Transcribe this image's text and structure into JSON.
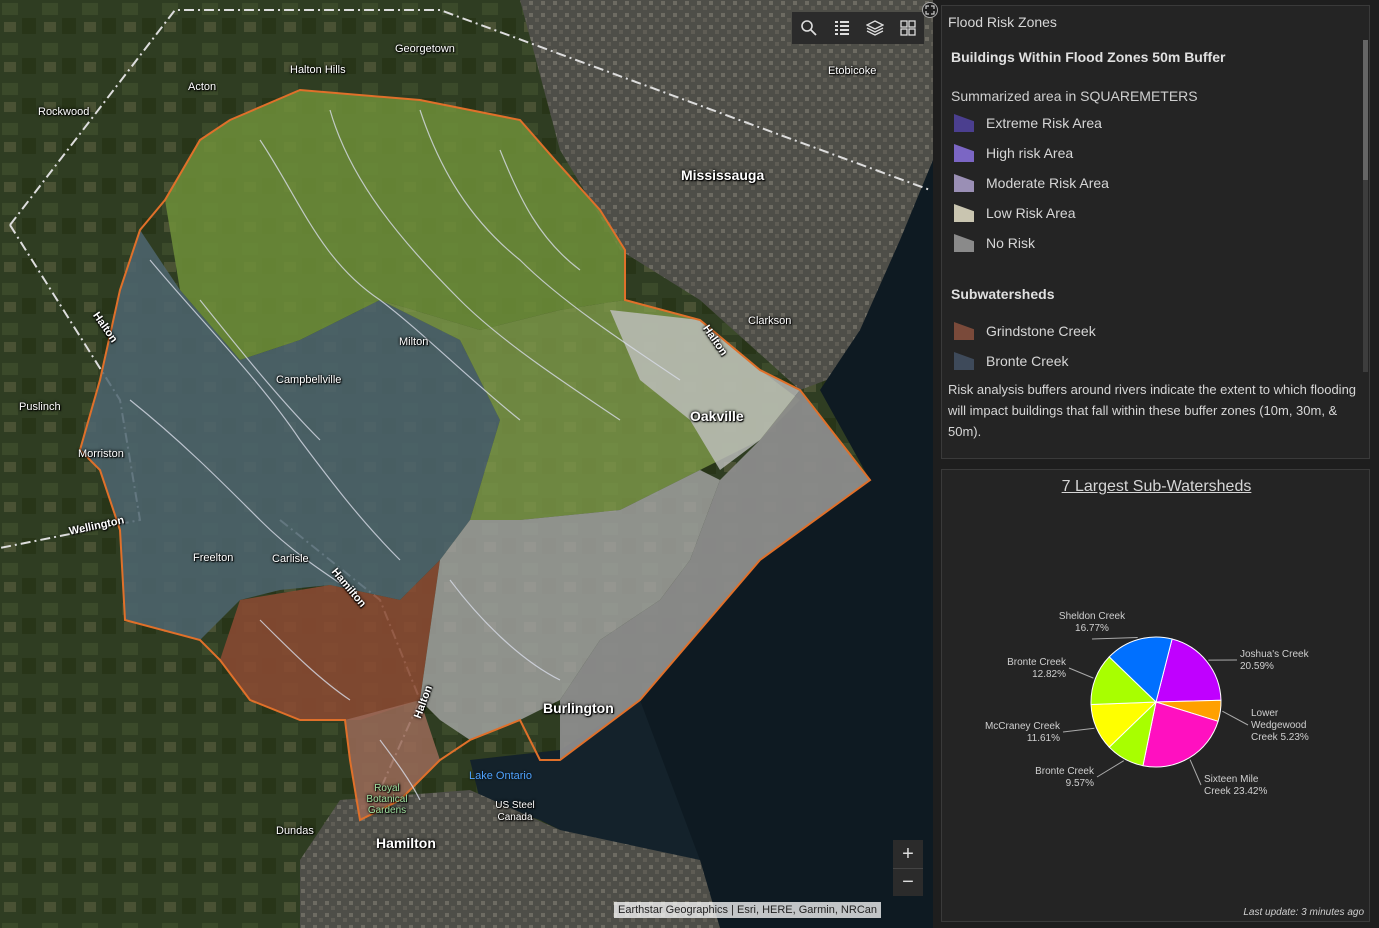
{
  "toolbar": {
    "search_icon": "search-icon",
    "legend_icon": "legend-list-icon",
    "layers_icon": "layers-icon",
    "basemap_icon": "basemap-gallery-icon"
  },
  "zoom": {
    "in_label": "+",
    "out_label": "−"
  },
  "attribution": "Earthstar Geographics | Esri, HERE, Garmin, NRCan",
  "map_labels": {
    "georgetown": "Georgetown",
    "halton_hills": "Halton Hills",
    "acton": "Acton",
    "rockwood": "Rockwood",
    "etobicoke": "Etobicoke",
    "mississauga": "Mississauga",
    "clarkson": "Clarkson",
    "milton": "Milton",
    "campbellville": "Campbellville",
    "puslinch": "Puslinch",
    "morriston": "Morriston",
    "oakville": "Oakville",
    "freelton": "Freelton",
    "carlisle": "Carlisle",
    "burlington": "Burlington",
    "lake_ontario": "Lake Ontario",
    "royal_botanical": "Royal Botanical Gardens",
    "us_steel": "US Steel Canada",
    "dundas": "Dundas",
    "hamilton": "Hamilton",
    "halton_1": "Halton",
    "halton_2": "Halton",
    "halton_3": "Halton",
    "halton_4": "Hamilton",
    "wellington": "Wellington"
  },
  "legend": {
    "panel_title": "Flood Risk Zones",
    "layer_title": "Buildings Within Flood Zones 50m Buffer",
    "summary_label": "Summarized area in SQUAREMETERS",
    "items": [
      {
        "label": "Extreme Risk Area",
        "color": "#4b3f8f"
      },
      {
        "label": "High risk Area",
        "color": "#7b66c4"
      },
      {
        "label": "Moderate Risk Area",
        "color": "#9a8fb5"
      },
      {
        "label": "Low Risk Area",
        "color": "#c9c5b0"
      },
      {
        "label": "No Risk",
        "color": "#8a8a8a"
      }
    ],
    "subwatersheds_title": "Subwatersheds",
    "sub_items": [
      {
        "label": "Grindstone Creek",
        "color": "#7a4a3a"
      },
      {
        "label": "Bronte Creek",
        "color": "#3e4a5a"
      }
    ],
    "description": "Risk analysis buffers around rivers indicate the extent to which flooding will impact buildings that fall within these buffer zones (10m, 30m, & 50m)."
  },
  "chart_panel": {
    "title": "7 Largest Sub-Watersheds",
    "last_update": "Last update: 3 minutes ago"
  },
  "chart_data": {
    "type": "pie",
    "title": "7 Largest Sub-Watersheds",
    "slices": [
      {
        "name": "Joshua's Creek",
        "value": 20.59,
        "label": "Joshua's Creek",
        "pct": "20.59%",
        "color": "#c000ff"
      },
      {
        "name": "Lower Wedgewood Creek",
        "value": 5.23,
        "label": "Lower Wedgewood Creek 5.23%",
        "pct": "",
        "color": "#ffa000"
      },
      {
        "name": "Sixteen Mile Creek",
        "value": 23.42,
        "label": "Sixteen Mile Creek 23.42%",
        "pct": "",
        "color": "#ff10c0"
      },
      {
        "name": "Bronte Creek",
        "value": 9.57,
        "label": "Bronte Creek",
        "pct": "9.57%",
        "color": "#a8ff00"
      },
      {
        "name": "McCraney Creek",
        "value": 11.61,
        "label": "McCraney Creek",
        "pct": "11.61%",
        "color": "#ffff00"
      },
      {
        "name": "Bronte Creek",
        "value": 12.82,
        "label": "Bronte Creek",
        "pct": "12.82%",
        "color": "#a8ff00"
      },
      {
        "name": "Sheldon Creek",
        "value": 16.77,
        "label": "Sheldon Creek",
        "pct": "16.77%",
        "color": "#0070ff"
      }
    ]
  }
}
